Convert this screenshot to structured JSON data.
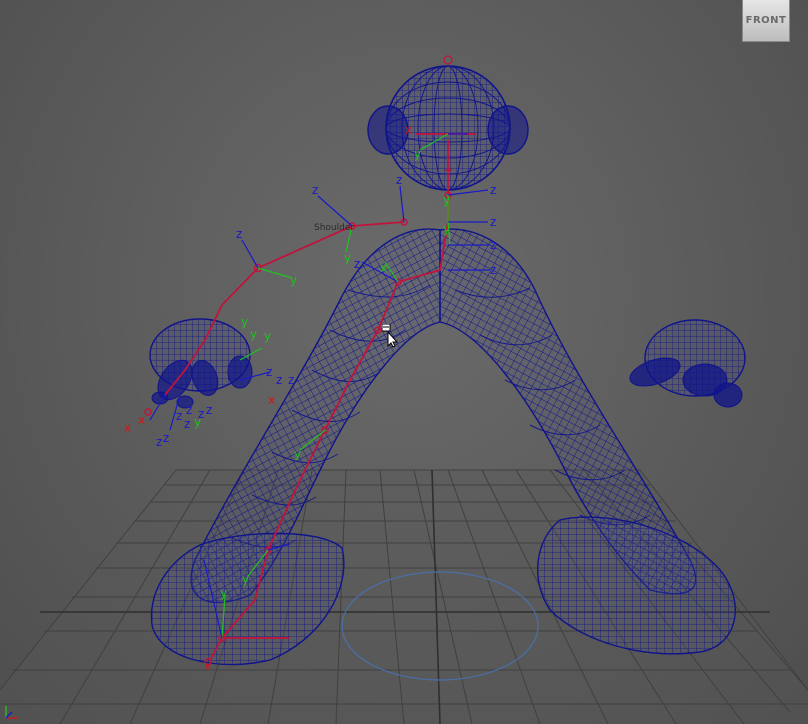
{
  "viewport": {
    "camera_label": "FRONT",
    "status_text": "",
    "colors": {
      "background": "#5d5d5d",
      "grid": "#3f3f3f",
      "mesh": "#10148a",
      "joint": "#c0143c",
      "axis_x": "#d01818",
      "axis_y": "#22c022",
      "axis_z": "#1a1ac8"
    }
  },
  "rig": {
    "labels": {
      "shoulder": "Shoulder"
    },
    "axis_letters": {
      "x": "x",
      "y": "y",
      "z": "z"
    }
  },
  "icons": {
    "viewcube": "viewcube-icon",
    "axis": "axis-indicator-icon",
    "cursor": "mouse-pointer-icon"
  }
}
